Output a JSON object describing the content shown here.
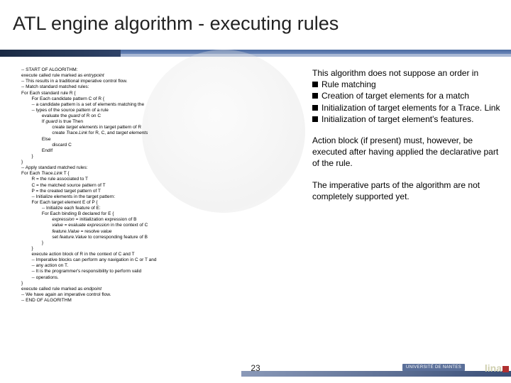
{
  "title": "ATL engine algorithm - executing rules",
  "algo": {
    "l1": "-- START OF ALGORITHM:",
    "l2": "execute called rule marked as ",
    "l2i": "entrypoint",
    "l3": "-- This results in a traditional imperative control flow.",
    "l4": "-- Match standard matched rules:",
    "l5": "For Each standard rule R {",
    "l6": "        For Each candidate pattern C of R {",
    "l7": "        -- a candidate pattern is a set of elements matching the",
    "l8": "        -- types of the source pattern of a rule",
    "l9": "                evaluate the ",
    "l9i": "guard",
    "l9b": " of R on C",
    "l10": "                If ",
    "l10i": "guard",
    "l10b": " is true Then",
    "l11a": "                        create ",
    "l11i": "target elements",
    "l11b": " in target pattern of R",
    "l12a": "                        create ",
    "l12i": "Trace.Link",
    "l12b": " for R, C, and ",
    "l12c": "target elements",
    "l13": "                Else",
    "l14": "                        discard C",
    "l15": "                EndIf",
    "l16": "        }",
    "l17": "}",
    "l18": "-- Apply standard matched rules:",
    "l19": "For Each ",
    "l19i": "Trace.Link",
    "l19b": " T {",
    "l20": "        R = the rule associated to T",
    "l21": "        C = the matched source pattern of T",
    "l22": "        P = the created target pattern of T",
    "l23": "        -- Initialize elements in the target pattern:",
    "l24": "        For Each target element E of P {",
    "l25": "                -- Initialize each feature of E:",
    "l26": "                For Each binding B declared for E {",
    "l27a": "                        ",
    "l27i": "expression",
    "l27b": " = initialization expression of B",
    "l28a": "                        ",
    "l28i": "value",
    "l28b": " = evaluate ",
    "l28c": "expression",
    "l28d": " in the context of C",
    "l29a": "                        ",
    "l29i": "feature.Value",
    "l29b": " = resolve ",
    "l29c": "value",
    "l30a": "                        set ",
    "l30i": "feature.Value",
    "l30b": " to corresponding feature of B",
    "l31": "                }",
    "l32": "        }",
    "l33": "        execute action block of R in the context of C and T",
    "l34": "        -- Imperative blocks can perform any navigation in C or T and",
    "l35": "        -- any action on T.",
    "l36": "        -- It is the programmer's responsibility to perform valid",
    "l37": "        -- operations.",
    "l38": "}",
    "l39": "execute called rule marked as ",
    "l39i": "endpoint",
    "l40": "-- We have again an imperative control flow.",
    "l41": "-- END OF ALGORITHM"
  },
  "right": {
    "p1": "This algorithm does not suppose an order in",
    "b1": "Rule matching",
    "b2": "Creation of target elements for a match",
    "b3": "Initialization of target elements for a Trace. Link",
    "b4": "Initialization of target element's features.",
    "p2": "Action block (if present) must, however, be executed after having applied the declarative part of the rule.",
    "p3": "The imperative parts of the algorithm are not completely supported yet."
  },
  "footer": {
    "page": "23",
    "logo1": "UNIVERSITÉ DE NANTES",
    "logo2": "lina"
  }
}
